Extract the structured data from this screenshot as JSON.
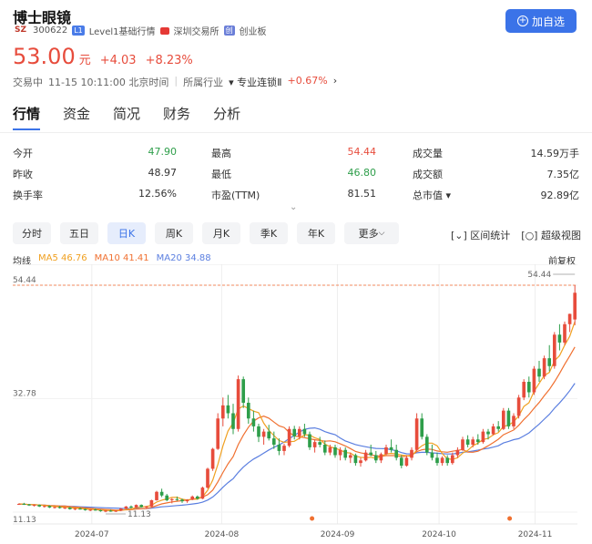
{
  "header": {
    "name": "博士眼镜",
    "market_badge": "SZ",
    "code": "300622",
    "level_badge": "L1",
    "level_text": "Level1基础行情",
    "exchange": "深圳交易所",
    "board_badge": "创",
    "board": "创业板",
    "add_button": "加自选"
  },
  "quote": {
    "price": "53.00",
    "unit": "元",
    "change": "+4.03",
    "change_pct": "+8.23%",
    "status": "交易中",
    "time": "11-15 10:11:00 北京时间",
    "industry_label": "所属行业",
    "industry_name": "专业连锁Ⅱ",
    "industry_change": "+0.67%",
    "chevron": "›"
  },
  "tabs": [
    "行情",
    "资金",
    "简况",
    "财务",
    "分析"
  ],
  "stats": [
    [
      {
        "label": "今开",
        "value": "47.90",
        "tone": "down"
      },
      {
        "label": "最高",
        "value": "54.44",
        "tone": "up"
      },
      {
        "label": "成交量",
        "value": "14.59万手",
        "tone": "flat"
      }
    ],
    [
      {
        "label": "昨收",
        "value": "48.97",
        "tone": "flat"
      },
      {
        "label": "最低",
        "value": "46.80",
        "tone": "down"
      },
      {
        "label": "成交额",
        "value": "7.35亿",
        "tone": "flat"
      }
    ],
    [
      {
        "label": "换手率",
        "value": "12.56%",
        "tone": "flat"
      },
      {
        "label": "市盈(TTM)",
        "value": "81.51",
        "tone": "flat"
      },
      {
        "label": "总市值 ▾",
        "value": "92.89亿",
        "tone": "flat"
      }
    ]
  ],
  "periods": [
    "分时",
    "五日",
    "日K",
    "周K",
    "月K",
    "季K",
    "年K",
    "更多"
  ],
  "active_period": "日K",
  "tools": {
    "interval_stats": "区间统计",
    "super_view": "超级视图"
  },
  "ma_legend": {
    "label": "均线",
    "ma5": "MA5 46.76",
    "ma10": "MA10 41.41",
    "ma20": "MA20 34.88",
    "ma5_color": "#f0a020",
    "ma10_color": "#f07030",
    "ma20_color": "#5b7fe0"
  },
  "adjust": "前复权",
  "chart_data": {
    "type": "candlestick",
    "y_ticks": [
      "54.44",
      "32.78",
      "11.13"
    ],
    "ylim": [
      11.13,
      54.44
    ],
    "x_ticks": [
      "2024-07",
      "2024-08",
      "2024-09",
      "2024-10",
      "2024-11"
    ],
    "high_label": "54.44",
    "low_label": "11.13",
    "candles": [
      [
        12.6,
        12.8,
        12.5,
        12.7
      ],
      [
        12.7,
        12.9,
        12.5,
        12.6
      ],
      [
        12.6,
        12.7,
        12.3,
        12.4
      ],
      [
        12.4,
        12.6,
        12.2,
        12.5
      ],
      [
        12.5,
        12.6,
        12.1,
        12.2
      ],
      [
        12.2,
        12.4,
        12.0,
        12.3
      ],
      [
        12.3,
        12.4,
        11.9,
        12.0
      ],
      [
        12.0,
        12.2,
        11.8,
        12.1
      ],
      [
        12.1,
        12.3,
        11.8,
        11.9
      ],
      [
        11.9,
        12.1,
        11.7,
        12.0
      ],
      [
        12.0,
        12.1,
        11.6,
        11.7
      ],
      [
        11.7,
        11.9,
        11.5,
        11.8
      ],
      [
        11.8,
        12.0,
        11.6,
        11.7
      ],
      [
        11.7,
        11.8,
        11.4,
        11.5
      ],
      [
        11.5,
        11.7,
        11.3,
        11.6
      ],
      [
        11.6,
        11.8,
        11.4,
        11.5
      ],
      [
        11.5,
        11.6,
        11.2,
        11.3
      ],
      [
        11.3,
        11.5,
        11.1,
        11.4
      ],
      [
        11.4,
        11.6,
        11.2,
        11.3
      ],
      [
        11.3,
        11.5,
        11.13,
        11.4
      ],
      [
        11.4,
        11.9,
        11.3,
        11.8
      ],
      [
        11.8,
        12.3,
        11.7,
        12.2
      ],
      [
        12.2,
        12.4,
        11.9,
        12.0
      ],
      [
        12.0,
        12.6,
        11.9,
        12.5
      ],
      [
        12.5,
        12.6,
        12.0,
        12.1
      ],
      [
        12.1,
        12.3,
        11.8,
        12.2
      ],
      [
        12.2,
        13.5,
        12.1,
        13.4
      ],
      [
        13.4,
        15.2,
        13.3,
        15.0
      ],
      [
        15.0,
        15.6,
        14.0,
        14.3
      ],
      [
        14.3,
        14.6,
        13.2,
        13.4
      ],
      [
        13.4,
        13.8,
        12.8,
        13.6
      ],
      [
        13.6,
        14.1,
        13.3,
        13.5
      ],
      [
        13.5,
        13.7,
        12.9,
        13.2
      ],
      [
        13.2,
        13.6,
        12.9,
        13.5
      ],
      [
        13.5,
        14.3,
        13.4,
        14.1
      ],
      [
        14.1,
        14.3,
        13.5,
        13.7
      ],
      [
        13.7,
        16.0,
        13.6,
        15.8
      ],
      [
        15.8,
        19.6,
        15.6,
        19.4
      ],
      [
        19.4,
        23.4,
        19.0,
        23.2
      ],
      [
        23.2,
        30.0,
        23.0,
        29.0
      ],
      [
        29.0,
        33.0,
        27.5,
        31.5
      ],
      [
        31.5,
        33.5,
        29.0,
        30.0
      ],
      [
        30.0,
        31.8,
        26.0,
        27.0
      ],
      [
        27.0,
        37.2,
        26.5,
        36.5
      ],
      [
        36.5,
        37.0,
        31.0,
        32.0
      ],
      [
        32.0,
        33.0,
        28.0,
        29.0
      ],
      [
        29.0,
        30.5,
        26.5,
        27.5
      ],
      [
        27.5,
        28.0,
        24.5,
        25.5
      ],
      [
        25.5,
        27.0,
        24.0,
        26.5
      ],
      [
        26.5,
        27.8,
        24.8,
        25.2
      ],
      [
        25.2,
        26.5,
        23.2,
        24.0
      ],
      [
        24.0,
        25.2,
        22.0,
        22.8
      ],
      [
        22.8,
        24.2,
        22.0,
        23.8
      ],
      [
        23.8,
        27.5,
        23.5,
        27.0
      ],
      [
        27.0,
        27.6,
        25.0,
        25.6
      ],
      [
        25.6,
        27.5,
        25.0,
        27.0
      ],
      [
        27.0,
        28.0,
        25.5,
        26.0
      ],
      [
        26.0,
        26.5,
        23.0,
        23.5
      ],
      [
        23.5,
        25.0,
        22.5,
        24.5
      ],
      [
        24.5,
        25.5,
        23.5,
        24.0
      ],
      [
        24.0,
        24.8,
        22.0,
        22.5
      ],
      [
        22.5,
        24.0,
        22.0,
        23.5
      ],
      [
        23.5,
        24.0,
        21.5,
        22.0
      ],
      [
        22.0,
        23.5,
        21.0,
        23.0
      ],
      [
        23.0,
        23.5,
        21.0,
        21.5
      ],
      [
        21.5,
        22.5,
        20.5,
        22.0
      ],
      [
        22.0,
        22.3,
        20.0,
        20.5
      ],
      [
        20.5,
        21.5,
        19.8,
        21.0
      ],
      [
        21.0,
        23.0,
        20.8,
        22.5
      ],
      [
        22.5,
        24.0,
        21.8,
        22.0
      ],
      [
        22.0,
        22.8,
        20.5,
        21.0
      ],
      [
        21.0,
        22.5,
        20.5,
        22.2
      ],
      [
        22.2,
        24.0,
        22.0,
        23.5
      ],
      [
        23.5,
        25.0,
        22.5,
        23.0
      ],
      [
        23.0,
        24.0,
        21.0,
        21.5
      ],
      [
        21.5,
        22.0,
        19.5,
        20.0
      ],
      [
        20.0,
        22.0,
        19.8,
        21.5
      ],
      [
        21.5,
        23.5,
        21.0,
        23.0
      ],
      [
        23.0,
        30.0,
        22.8,
        29.0
      ],
      [
        29.0,
        30.0,
        25.0,
        25.5
      ],
      [
        25.5,
        26.0,
        22.0,
        22.5
      ],
      [
        22.5,
        24.0,
        21.0,
        21.5
      ],
      [
        21.5,
        22.5,
        20.0,
        20.5
      ],
      [
        20.5,
        21.8,
        20.0,
        21.5
      ],
      [
        21.5,
        22.0,
        20.0,
        20.5
      ],
      [
        20.5,
        22.5,
        20.2,
        22.0
      ],
      [
        22.0,
        23.5,
        21.5,
        23.0
      ],
      [
        23.0,
        25.5,
        22.8,
        25.0
      ],
      [
        25.0,
        25.8,
        23.5,
        24.0
      ],
      [
        24.0,
        25.5,
        23.5,
        25.0
      ],
      [
        25.0,
        26.0,
        24.0,
        24.5
      ],
      [
        24.5,
        27.0,
        24.2,
        26.5
      ],
      [
        26.5,
        27.0,
        25.0,
        26.0
      ],
      [
        26.0,
        28.0,
        25.8,
        27.5
      ],
      [
        27.5,
        28.5,
        26.5,
        27.0
      ],
      [
        27.0,
        31.0,
        26.8,
        30.5
      ],
      [
        30.5,
        31.0,
        27.0,
        27.5
      ],
      [
        27.5,
        30.0,
        27.0,
        29.5
      ],
      [
        29.5,
        33.5,
        29.0,
        33.0
      ],
      [
        33.0,
        36.5,
        32.5,
        36.0
      ],
      [
        36.0,
        37.0,
        33.0,
        34.0
      ],
      [
        34.0,
        39.0,
        33.5,
        38.5
      ],
      [
        38.5,
        40.0,
        36.0,
        37.0
      ],
      [
        37.0,
        41.0,
        36.5,
        40.5
      ],
      [
        40.5,
        43.0,
        38.0,
        39.0
      ],
      [
        39.0,
        45.5,
        38.5,
        45.0
      ],
      [
        45.0,
        47.0,
        42.0,
        43.5
      ],
      [
        43.5,
        47.5,
        43.0,
        47.0
      ],
      [
        47.0,
        49.0,
        45.5,
        48.97
      ],
      [
        47.9,
        54.44,
        46.8,
        53.0
      ]
    ]
  }
}
